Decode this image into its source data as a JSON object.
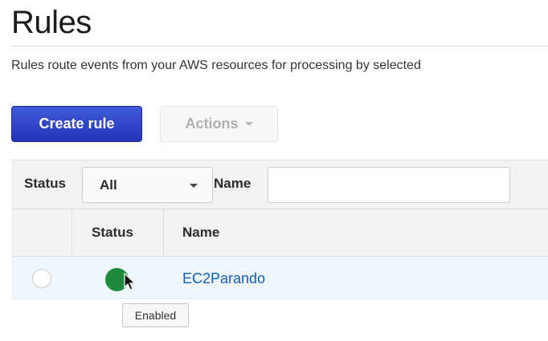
{
  "page": {
    "title": "Rules",
    "description": "Rules route events from your AWS resources for processing by selected"
  },
  "toolbar": {
    "create_label": "Create rule",
    "actions_label": "Actions"
  },
  "filter": {
    "status_label": "Status",
    "status_value": "All",
    "name_label": "Name",
    "name_value": ""
  },
  "table": {
    "headers": {
      "status": "Status",
      "name": "Name"
    },
    "rows": [
      {
        "status": "Enabled",
        "name": "EC2Parando",
        "status_color": "#1d8a3c"
      }
    ]
  },
  "tooltip": {
    "text": "Enabled"
  },
  "colors": {
    "primary_button": "#2336b7",
    "link": "#0f5fb3",
    "enabled_status": "#1d8a3c",
    "selected_row": "#eef5fb"
  },
  "icons": [
    "chevron-down-icon",
    "status-dot-icon",
    "mouse-cursor-icon"
  ]
}
